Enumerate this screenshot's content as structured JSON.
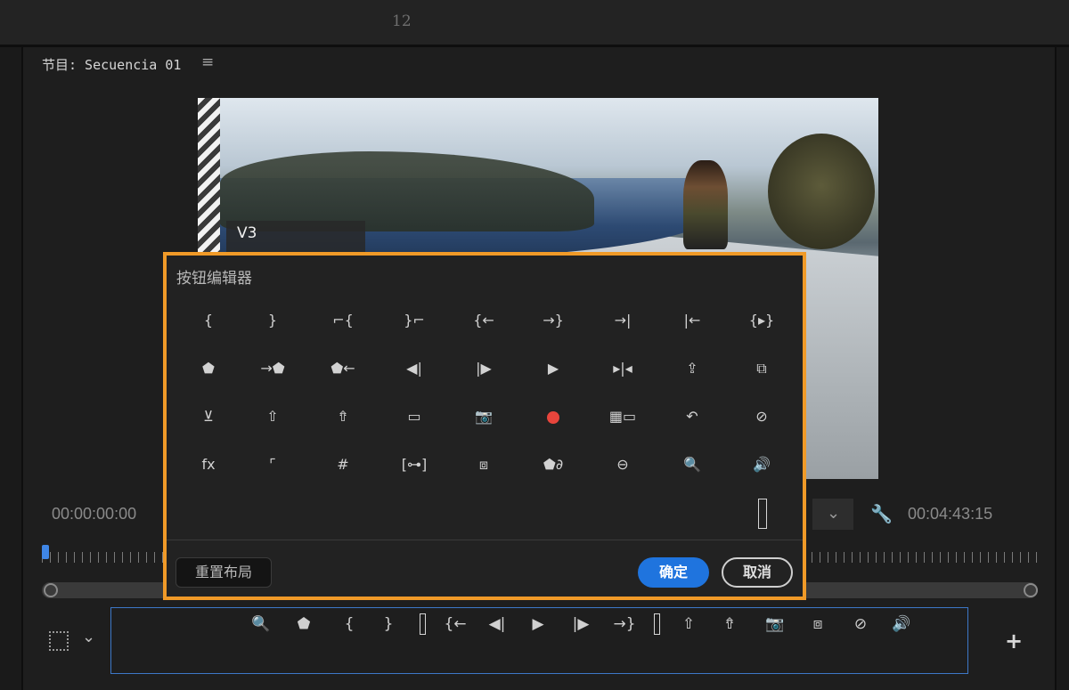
{
  "topbar": {
    "number": "12"
  },
  "panel": {
    "title": "节目: Secuencia 01",
    "menu_icon": "≡"
  },
  "video": {
    "track_label": "V3"
  },
  "timecode": {
    "current": "00:00:00:00",
    "duration": "00:04:43:15"
  },
  "dialog": {
    "title": "按钮编辑器",
    "icons": [
      {
        "name": "mark-in-icon",
        "glyph": "{"
      },
      {
        "name": "mark-out-icon",
        "glyph": "}"
      },
      {
        "name": "clear-in-icon",
        "glyph": "⌐{"
      },
      {
        "name": "clear-out-icon",
        "glyph": "}⌐"
      },
      {
        "name": "go-to-in-icon",
        "glyph": "{←"
      },
      {
        "name": "go-to-out-icon",
        "glyph": "→}"
      },
      {
        "name": "go-to-next-edit-icon",
        "glyph": "→|"
      },
      {
        "name": "go-to-prev-edit-icon",
        "glyph": "|←"
      },
      {
        "name": "play-in-to-out-icon",
        "glyph": "{▸}"
      },
      {
        "name": "add-marker-icon",
        "glyph": "⬟"
      },
      {
        "name": "go-to-next-marker-icon",
        "glyph": "→⬟"
      },
      {
        "name": "go-to-prev-marker-icon",
        "glyph": "⬟←"
      },
      {
        "name": "step-back-icon",
        "glyph": "◀|"
      },
      {
        "name": "step-forward-icon",
        "glyph": "|▶"
      },
      {
        "name": "play-icon",
        "glyph": "▶"
      },
      {
        "name": "play-around-icon",
        "glyph": "▸|◂"
      },
      {
        "name": "export-frame-lift-icon",
        "glyph": "⇪"
      },
      {
        "name": "insert-icon",
        "glyph": "⧉"
      },
      {
        "name": "overwrite-icon",
        "glyph": "⊻"
      },
      {
        "name": "lift-icon",
        "glyph": "⇧"
      },
      {
        "name": "extract-icon",
        "glyph": "⇮"
      },
      {
        "name": "safe-margins-icon",
        "glyph": "▭"
      },
      {
        "name": "camera-icon",
        "glyph": "📷"
      },
      {
        "name": "record-icon",
        "glyph": "●"
      },
      {
        "name": "multi-camera-icon",
        "glyph": "▦▭"
      },
      {
        "name": "undo-trim-icon",
        "glyph": "↶"
      },
      {
        "name": "proxy-toggle-icon",
        "glyph": "⊘"
      },
      {
        "name": "fx-icon",
        "glyph": "fx"
      },
      {
        "name": "vr-ruler-icon",
        "glyph": "⌜"
      },
      {
        "name": "grid-icon",
        "glyph": "#"
      },
      {
        "name": "trim-icon",
        "glyph": "[⊶]"
      },
      {
        "name": "compare-view-icon",
        "glyph": "⧈"
      },
      {
        "name": "marker-link-icon",
        "glyph": "⬟∂"
      },
      {
        "name": "vr-video-icon",
        "glyph": "⊖"
      },
      {
        "name": "zoom-search-icon",
        "glyph": "🔍"
      },
      {
        "name": "volume-icon",
        "glyph": "🔊"
      }
    ],
    "spacer_icon": "spacer",
    "reset_label": "重置布局",
    "ok_label": "确定",
    "cancel_label": "取消"
  },
  "colors": {
    "accent": "#1f74de",
    "dialog_border": "#f09a28",
    "record": "#e8453c",
    "selection_border": "#3d78c8"
  },
  "transport_icons": [
    "zoom-search-icon",
    "add-marker-icon",
    "mark-in-icon",
    "mark-out-icon",
    "spacer-icon",
    "go-to-in-icon",
    "step-back-icon",
    "play-icon",
    "step-forward-icon",
    "go-to-out-icon",
    "spacer-icon",
    "lift-icon",
    "extract-icon",
    "camera-icon",
    "compare-view-icon",
    "proxy-toggle-icon",
    "volume-icon"
  ]
}
